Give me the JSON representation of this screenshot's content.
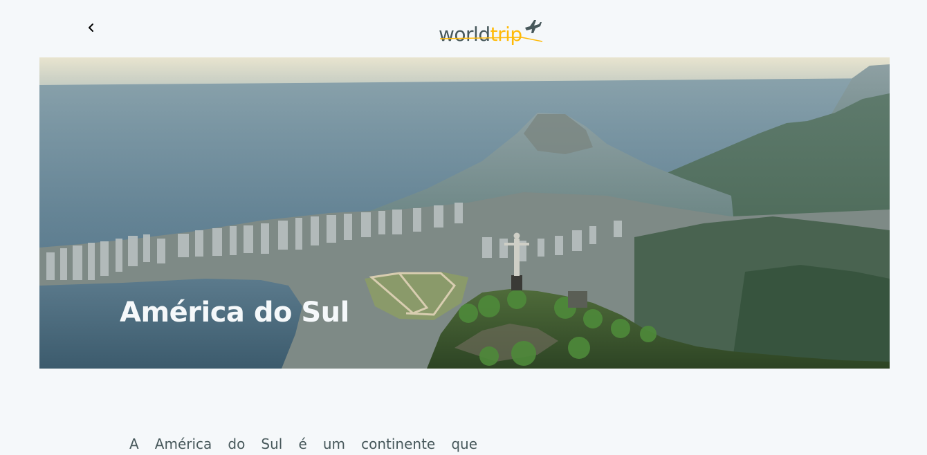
{
  "header": {
    "logo": {
      "part1": "world",
      "part2": "trip",
      "icon": "airplane-icon"
    },
    "back_icon": "chevron-left-icon"
  },
  "banner": {
    "title": "América do Sul"
  },
  "content": {
    "description": "A América do Sul é um continente que"
  },
  "colors": {
    "background": "#f5f8fa",
    "text": "#47585b",
    "accent": "#ffba08",
    "title": "#f5f8fa"
  }
}
